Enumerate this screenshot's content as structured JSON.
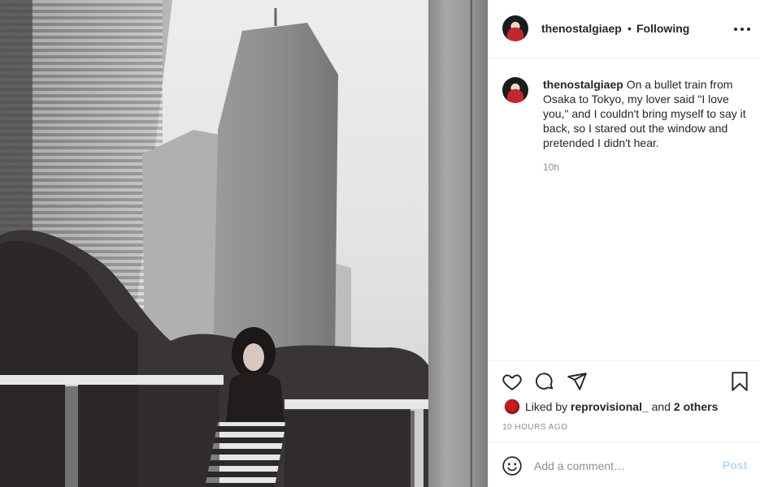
{
  "post": {
    "username": "thenostalgiaep",
    "dot": "•",
    "follow_label": "Following",
    "caption_text": "On a bullet train from Osaka to Tokyo, my lover said \"I love you,\" and I couldn't bring myself to say it back, so I stared out the window and pretended I didn't hear.",
    "relative_time": "10h",
    "liked_by_prefix": "Liked by",
    "liked_by_user": "reprovisional_",
    "liked_by_and": "and",
    "liked_by_others": "2 others",
    "post_time": "10 HOURS AGO"
  },
  "comment": {
    "placeholder": "Add a comment…",
    "post_label": "Post"
  },
  "icons": {
    "more": "more-options-icon",
    "like": "heart-icon",
    "comment": "comment-bubble-icon",
    "share": "paper-plane-icon",
    "save": "bookmark-icon",
    "emoji": "emoji-smiley-icon"
  },
  "colors": {
    "text": "#262626",
    "muted": "#8e8e8e",
    "divider": "#efefef",
    "post_disabled": "#b3dbff"
  }
}
